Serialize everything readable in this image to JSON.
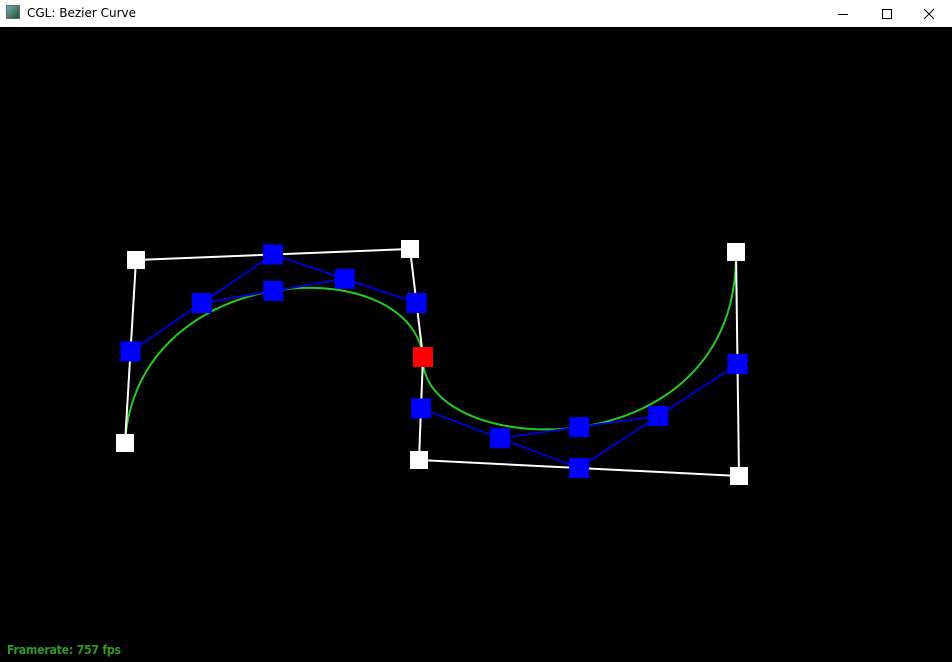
{
  "window": {
    "title": "CGL: Bezier Curve",
    "icon": "app-window-icon",
    "controls": {
      "minimize": "minimize-icon",
      "maximize": "maximize-icon",
      "close": "close-icon"
    }
  },
  "status": {
    "framerate_label": "Framerate: 757 fps"
  },
  "colors": {
    "background": "#000000",
    "control_polygon": "#ffffff",
    "control_points": "#ffffff",
    "intermediate_lines": "#0000cc",
    "intermediate_points": "#0000ff",
    "curve": "#22cc22",
    "evaluated_point": "#ff0000",
    "framerate_text": "#2e9a25"
  }
}
